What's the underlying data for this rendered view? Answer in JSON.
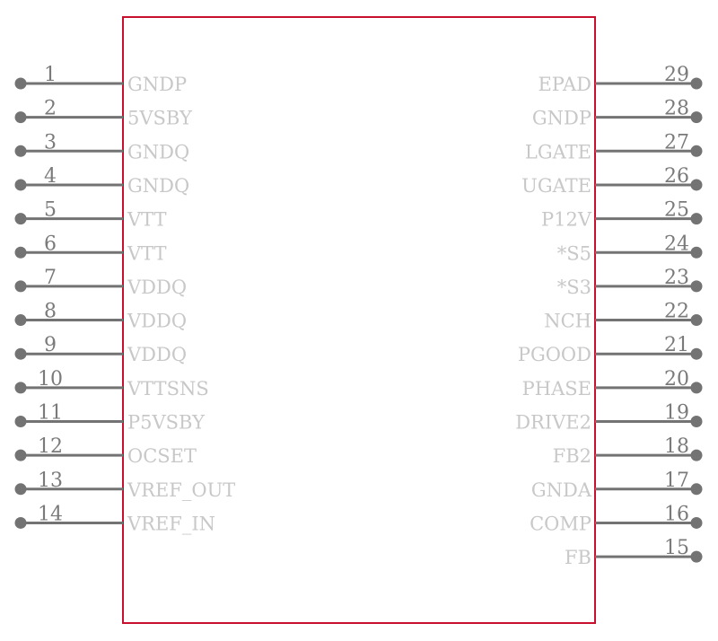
{
  "component": {
    "box_color": "#c8102e",
    "pin_color": "#737373",
    "label_color": "#c8c8c8",
    "left_pins": [
      {
        "number": "1",
        "name": "GNDP"
      },
      {
        "number": "2",
        "name": "5VSBY"
      },
      {
        "number": "3",
        "name": "GNDQ"
      },
      {
        "number": "4",
        "name": "GNDQ"
      },
      {
        "number": "5",
        "name": "VTT"
      },
      {
        "number": "6",
        "name": "VTT"
      },
      {
        "number": "7",
        "name": "VDDQ"
      },
      {
        "number": "8",
        "name": "VDDQ"
      },
      {
        "number": "9",
        "name": "VDDQ"
      },
      {
        "number": "10",
        "name": "VTTSNS"
      },
      {
        "number": "11",
        "name": "P5VSBY"
      },
      {
        "number": "12",
        "name": "OCSET"
      },
      {
        "number": "13",
        "name": "VREF_OUT"
      },
      {
        "number": "14",
        "name": "VREF_IN"
      }
    ],
    "right_pins": [
      {
        "number": "29",
        "name": "EPAD"
      },
      {
        "number": "28",
        "name": "GNDP"
      },
      {
        "number": "27",
        "name": "LGATE"
      },
      {
        "number": "26",
        "name": "UGATE"
      },
      {
        "number": "25",
        "name": "P12V"
      },
      {
        "number": "24",
        "name": "*S5"
      },
      {
        "number": "23",
        "name": "*S3"
      },
      {
        "number": "22",
        "name": "NCH"
      },
      {
        "number": "21",
        "name": "PGOOD"
      },
      {
        "number": "20",
        "name": "PHASE"
      },
      {
        "number": "19",
        "name": "DRIVE2"
      },
      {
        "number": "18",
        "name": "FB2"
      },
      {
        "number": "17",
        "name": "GNDA"
      },
      {
        "number": "16",
        "name": "COMP"
      },
      {
        "number": "15",
        "name": "FB"
      }
    ]
  }
}
